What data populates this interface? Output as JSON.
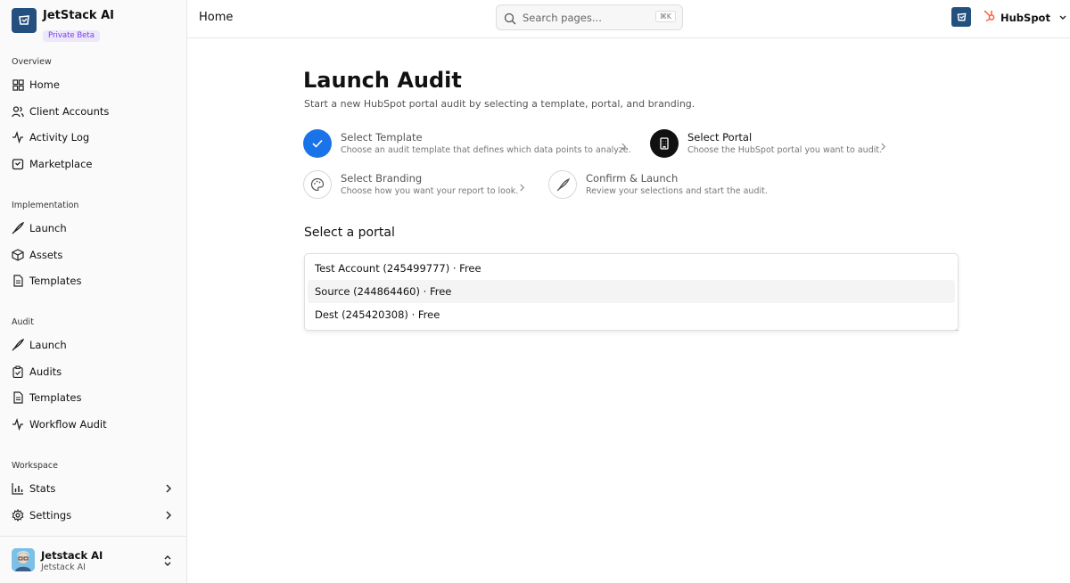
{
  "brand": {
    "name": "JetStack AI",
    "badge": "Private Beta"
  },
  "sidebar": {
    "sections": [
      {
        "label": "Overview",
        "items": [
          {
            "label": "Home",
            "icon": "grid-icon"
          },
          {
            "label": "Client Accounts",
            "icon": "users-icon"
          },
          {
            "label": "Activity Log",
            "icon": "activity-icon"
          },
          {
            "label": "Marketplace",
            "icon": "store-icon"
          }
        ]
      },
      {
        "label": "Implementation",
        "items": [
          {
            "label": "Launch",
            "icon": "rocket-icon"
          },
          {
            "label": "Assets",
            "icon": "box-icon"
          },
          {
            "label": "Templates",
            "icon": "file-icon"
          }
        ]
      },
      {
        "label": "Audit",
        "items": [
          {
            "label": "Launch",
            "icon": "rocket-icon"
          },
          {
            "label": "Audits",
            "icon": "clipboard-icon"
          },
          {
            "label": "Templates",
            "icon": "file-icon"
          },
          {
            "label": "Workflow Audit",
            "icon": "activity-icon"
          }
        ]
      },
      {
        "label": "Workspace",
        "items": [
          {
            "label": "Stats",
            "icon": "bar-chart-icon"
          },
          {
            "label": "Settings",
            "icon": "gear-icon"
          }
        ]
      }
    ]
  },
  "user": {
    "name": "Jetstack AI",
    "subtitle": "Jetstack AI"
  },
  "header": {
    "title": "Home",
    "search_placeholder": "Search pages...",
    "shortcut": "⌘K",
    "account": "HubSpot"
  },
  "main": {
    "title": "Launch Audit",
    "subtitle": "Start a new HubSpot portal audit by selecting a template, portal, and branding.",
    "steps": [
      {
        "title": "Select Template",
        "desc": "Choose an audit template that defines which data points to analyze.",
        "state": "done"
      },
      {
        "title": "Select Portal",
        "desc": "Choose the HubSpot portal you want to audit.",
        "state": "active"
      },
      {
        "title": "Select Branding",
        "desc": "Choose how you want your report to look.",
        "state": "pending"
      },
      {
        "title": "Confirm & Launch",
        "desc": "Review your selections and start the audit.",
        "state": "pending"
      }
    ],
    "section_title": "Select a portal",
    "portal_options": [
      "Test Account (245499777) · Free",
      "Source (244864460) · Free",
      "Dest (245420308) · Free"
    ],
    "highlighted_option": 1
  },
  "colors": {
    "accent": "#1a73e8",
    "brand": "#23507f",
    "badge_text": "#7c3aed",
    "hubspot": "#ff5c35"
  }
}
